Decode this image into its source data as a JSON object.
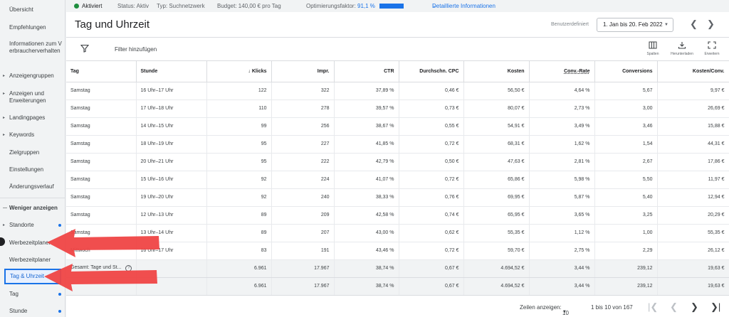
{
  "sidebar": {
    "items": [
      {
        "label": "Übersicht"
      },
      {
        "label": "Empfehlungen"
      },
      {
        "label": "Informationen zum Verbraucherverhalten"
      },
      {
        "label": "Anzeigengruppen"
      },
      {
        "label": "Anzeigen und Erweiterungen"
      },
      {
        "label": "Landingpages"
      },
      {
        "label": "Keywords"
      },
      {
        "label": "Zielgruppen"
      },
      {
        "label": "Einstellungen"
      },
      {
        "label": "Änderungsverlauf"
      },
      {
        "label": "Weniger anzeigen"
      },
      {
        "label": "Standorte"
      },
      {
        "label": "Werbezeitplaner"
      },
      {
        "label": "Werbezeitplaner"
      },
      {
        "label": "Tag & Uhrzeit"
      },
      {
        "label": "Tag"
      },
      {
        "label": "Stunde"
      }
    ]
  },
  "topbar": {
    "status": "Aktiviert",
    "status_label": "Status: Aktiv",
    "type_label": "Typ: Suchnetzwerk",
    "budget_label": "Budget: 140,00 € pro Tag",
    "opt_label": "Optimierungsfaktor:",
    "opt_value": "91,1 %",
    "details_link": "Detaillierte Informationen"
  },
  "header": {
    "title": "Tag und Uhrzeit",
    "date_mode": "Benutzerdefiniert",
    "date_range": "1. Jan bis 20. Feb 2022"
  },
  "toolbar": {
    "filter_placeholder": "Filter hinzufügen",
    "columns_label": "Spalten",
    "download_label": "Herunterladen",
    "expand_label": "Erweitern"
  },
  "table": {
    "headers": [
      "Tag",
      "Stunde",
      "Klicks",
      "Impr.",
      "CTR",
      "Durchschn. CPC",
      "Kosten",
      "Conv.-Rate",
      "Conversions",
      "Kosten/Conv."
    ],
    "rows": [
      [
        "Samstag",
        "16 Uhr–17 Uhr",
        "122",
        "322",
        "37,89 %",
        "0,46 €",
        "56,50 €",
        "4,64 %",
        "5,67",
        "9,97 €"
      ],
      [
        "Samstag",
        "17 Uhr–18 Uhr",
        "110",
        "278",
        "39,57 %",
        "0,73 €",
        "80,07 €",
        "2,73 %",
        "3,00",
        "26,69 €"
      ],
      [
        "Samstag",
        "14 Uhr–15 Uhr",
        "99",
        "256",
        "38,67 %",
        "0,55 €",
        "54,91 €",
        "3,49 %",
        "3,46",
        "15,88 €"
      ],
      [
        "Samstag",
        "18 Uhr–19 Uhr",
        "95",
        "227",
        "41,85 %",
        "0,72 €",
        "68,31 €",
        "1,62 %",
        "1,54",
        "44,31 €"
      ],
      [
        "Samstag",
        "20 Uhr–21 Uhr",
        "95",
        "222",
        "42,79 %",
        "0,50 €",
        "47,63 €",
        "2,81 %",
        "2,67",
        "17,86 €"
      ],
      [
        "Samstag",
        "15 Uhr–16 Uhr",
        "92",
        "224",
        "41,07 %",
        "0,72 €",
        "65,86 €",
        "5,98 %",
        "5,50",
        "11,97 €"
      ],
      [
        "Samstag",
        "19 Uhr–20 Uhr",
        "92",
        "240",
        "38,33 %",
        "0,76 €",
        "69,95 €",
        "5,87 %",
        "5,40",
        "12,94 €"
      ],
      [
        "Samstag",
        "12 Uhr–13 Uhr",
        "89",
        "209",
        "42,58 %",
        "0,74 €",
        "65,95 €",
        "3,65 %",
        "3,25",
        "20,29 €"
      ],
      [
        "Samstag",
        "13 Uhr–14 Uhr",
        "89",
        "207",
        "43,00 %",
        "0,62 €",
        "55,35 €",
        "1,12 %",
        "1,00",
        "55,35 €"
      ],
      [
        "Mittwoch",
        "16 Uhr–17 Uhr",
        "83",
        "191",
        "43,46 %",
        "0,72 €",
        "59,70 €",
        "2,75 %",
        "2,29",
        "26,12 €"
      ]
    ],
    "total1": [
      "Gesamt: Tage und St...",
      "",
      "6.961",
      "17.967",
      "38,74 %",
      "0,67 €",
      "4.694,52 €",
      "3,44 %",
      "239,12",
      "19,63 €"
    ],
    "total2": [
      "",
      "",
      "6.961",
      "17.967",
      "38,74 %",
      "0,67 €",
      "4.694,52 €",
      "3,44 %",
      "239,12",
      "19,63 €"
    ]
  },
  "pager": {
    "rows_label": "Zeilen anzeigen:",
    "rows_value": "10",
    "range": "1 bis 10 von 167"
  }
}
